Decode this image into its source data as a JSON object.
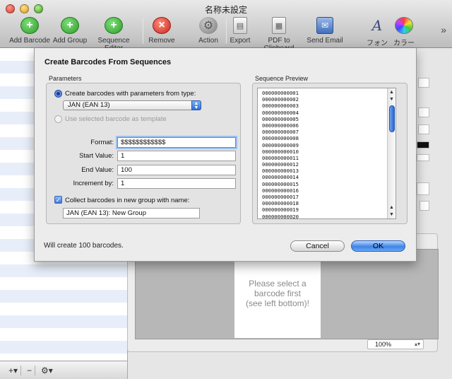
{
  "window": {
    "title": "名称未設定"
  },
  "toolbar": {
    "items": [
      {
        "label": "Add Barcode",
        "icon": "plus-circle-icon"
      },
      {
        "label": "Add Group",
        "icon": "plus-circle-icon"
      },
      {
        "label": "Sequence Editor",
        "icon": "plus-circle-icon"
      },
      {
        "label": "Remove",
        "icon": "x-circle-icon"
      },
      {
        "label": "Action",
        "icon": "gear-icon"
      },
      {
        "label": "Export",
        "icon": "document-icon"
      },
      {
        "label": "PDF to Clipboard",
        "icon": "clipboard-icon"
      },
      {
        "label": "Send Email",
        "icon": "email-icon"
      },
      {
        "label": "フォント",
        "icon": "font-icon"
      },
      {
        "label": "カラー",
        "icon": "color-wheel-icon"
      }
    ],
    "overflow": "»"
  },
  "sidebar_footer": {
    "add": "+▾",
    "remove": "−",
    "action": "⚙▾"
  },
  "preview": {
    "message": "Please select a\nbarcode first\n(see left bottom)!",
    "zoom": "100%"
  },
  "sheet": {
    "title": "Create Barcodes From Sequences",
    "parameters": {
      "group_label": "Parameters",
      "radio_type_label": "Create barcodes with parameters from type:",
      "type_value": "JAN (EAN 13)",
      "radio_template_label": "Use selected barcode as template",
      "format_label": "Format:",
      "format_value": "$$$$$$$$$$$$",
      "start_label": "Start Value:",
      "start_value": "1",
      "end_label": "End Value:",
      "end_value": "100",
      "increment_label": "Increment by:",
      "increment_value": "1",
      "collect_label": "Collect barcodes in new group with name:",
      "collect_checked": true,
      "group_name_value": "JAN (EAN 13): New Group"
    },
    "sequence_preview": {
      "label": "Sequence Preview",
      "items": [
        "000000000001",
        "000000000002",
        "000000000003",
        "000000000004",
        "000000000005",
        "000000000006",
        "000000000007",
        "000000000008",
        "000000000009",
        "000000000010",
        "000000000011",
        "000000000012",
        "000000000013",
        "000000000014",
        "000000000015",
        "000000000016",
        "000000000017",
        "000000000018",
        "000000000019",
        "000000000020"
      ]
    },
    "status": "Will create 100 barcodes.",
    "cancel_label": "Cancel",
    "ok_label": "OK"
  }
}
